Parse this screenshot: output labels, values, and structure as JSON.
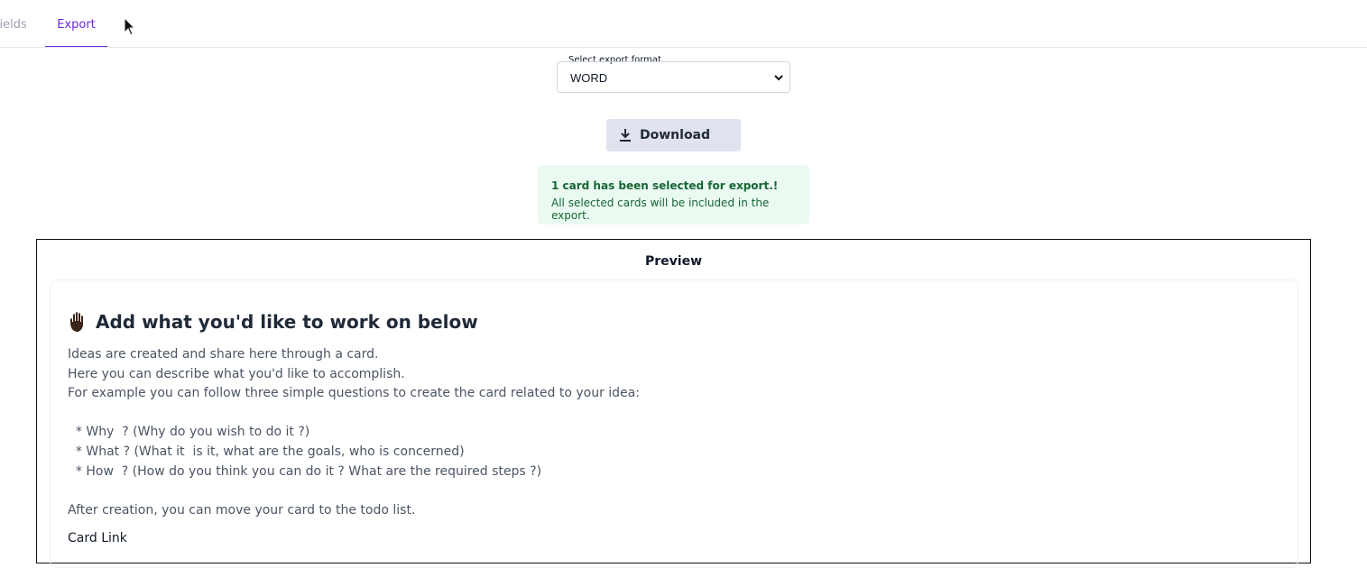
{
  "tabs": {
    "fields_label": "Fields",
    "export_label": "Export"
  },
  "export": {
    "select_label": "Select export format.",
    "selected_format": "WORD",
    "download_label": "Download"
  },
  "alert": {
    "title": "1 card has been selected for export.!",
    "text": "All selected cards will be included in the export."
  },
  "preview": {
    "heading": "Preview",
    "card": {
      "title": "Add what you'd like to work on below",
      "description": "Ideas are created and share here through a card.\nHere you can describe what you'd like to accomplish.\nFor example you can follow three simple questions to create the card related to your idea:\n\n  * Why  ? (Why do you wish to do it ?)\n  * What ? (What it  is it, what are the goals, who is concerned)\n  * How  ? (How do you think you can do it ? What are the required steps ?)\n\nAfter creation, you can move your card to the todo list.",
      "link_label": "Card Link"
    }
  },
  "colors": {
    "accent": "#6d28d9",
    "success_bg": "#eafaf1",
    "success_text": "#166534"
  },
  "icons": {
    "download": "download-icon",
    "hand": "raised-hand-icon",
    "cursor": "mouse-cursor-icon",
    "chevron": "chevron-down-icon"
  }
}
